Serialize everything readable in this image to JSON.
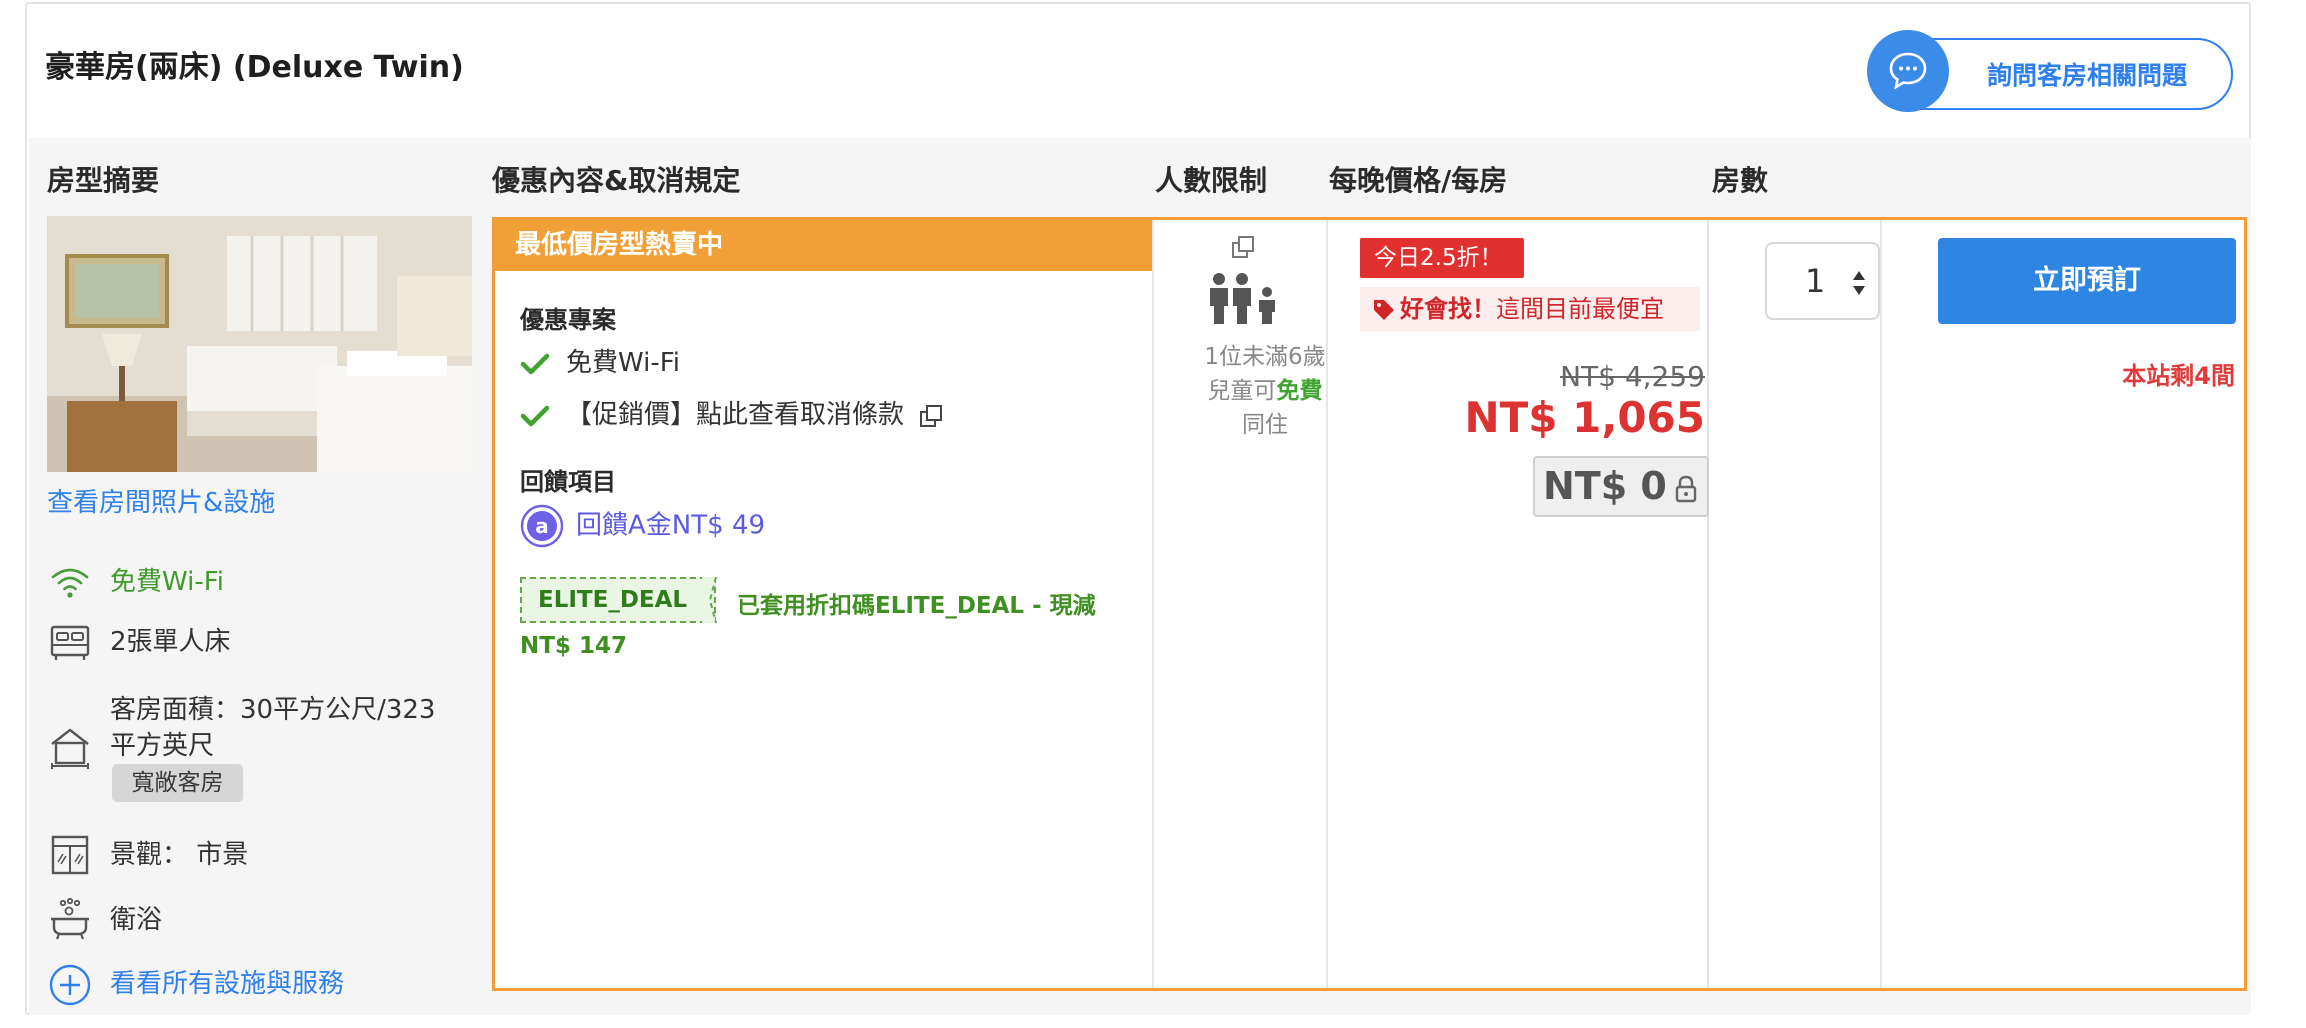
{
  "room": {
    "title": "豪華房(兩床) (Deluxe Twin)",
    "ask_button": "詢問客房相關問題"
  },
  "columns": {
    "summary": "房型摘要",
    "offers": "優惠內容&取消規定",
    "occupancy": "人數限制",
    "price": "每晚價格/每房",
    "rooms": "房數"
  },
  "summary": {
    "photo_link": "查看房間照片&設施",
    "amenities": [
      {
        "icon": "wifi-icon",
        "label": "免費Wi-Fi"
      },
      {
        "icon": "bed-icon",
        "label": "2張單人床"
      },
      {
        "icon": "house-icon",
        "label_line1": "客房面積：30平方公尺/323",
        "label_line2": "平方英尺"
      },
      {
        "icon": "window-icon",
        "label": "景觀： 市景"
      },
      {
        "icon": "bathtub-icon",
        "label": "衛浴"
      }
    ],
    "badge": "寬敞客房",
    "more_link": "看看所有設施與服務"
  },
  "offer": {
    "banner": "最低價房型熱賣中",
    "promo_title": "優惠專案",
    "promo_items": [
      "免費Wi-Fi",
      "【促銷價】點此查看取消條款"
    ],
    "reward_title": "回饋項目",
    "reward_text": "回饋A金NT$ 49",
    "coupon_code": "ELITE_DEAL",
    "coupon_text": "已套用折扣碼ELITE_DEAL - 現減",
    "coupon_amount": "NT$ 147"
  },
  "occupancy": {
    "line1": "1位未滿6歲",
    "line2_prefix": "兒童可",
    "line2_free": "免費",
    "line3": "同住"
  },
  "pricing": {
    "discount_tag": "今日2.5折！",
    "good_find": "好會找！",
    "good_find_text": "這間目前最便宜",
    "original_price": "NT$ 4,259",
    "price": "NT$ 1,065",
    "points_price": "NT$ 0"
  },
  "booking": {
    "quantity": "1",
    "book_button": "立即預訂",
    "remaining": "本站剩4間"
  },
  "colors": {
    "accent_blue": "#2f86e2",
    "offer_orange": "#f0a037",
    "price_red": "#dc3232",
    "green": "#3fa32e"
  }
}
